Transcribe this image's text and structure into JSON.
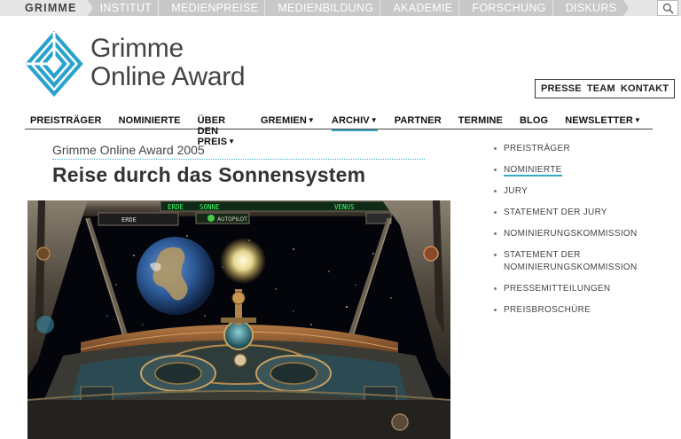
{
  "topbar": {
    "brand": "GRIMME",
    "items": [
      "INSTITUT",
      "MEDIENPREISE",
      "MEDIENBILDUNG",
      "AKADEMIE",
      "FORSCHUNG",
      "DISKURS"
    ]
  },
  "logo": {
    "line1": "Grimme",
    "line2": "Online Award"
  },
  "util": [
    "PRESSE",
    "TEAM",
    "KONTAKT"
  ],
  "mainnav": [
    {
      "label": "PREISTRÄGER",
      "dropdown": false
    },
    {
      "label": "NOMINIERTE",
      "dropdown": false
    },
    {
      "label": "ÜBER DEN PREIS",
      "dropdown": true
    },
    {
      "label": "GREMIEN",
      "dropdown": true
    },
    {
      "label": "ARCHIV",
      "dropdown": true,
      "active": true
    },
    {
      "label": "PARTNER",
      "dropdown": false
    },
    {
      "label": "TERMINE",
      "dropdown": false
    },
    {
      "label": "BLOG",
      "dropdown": false
    },
    {
      "label": "NEWSLETTER",
      "dropdown": true
    }
  ],
  "article": {
    "subtitle": "Grimme Online Award 2005",
    "title": "Reise durch das Sonnensystem"
  },
  "media": {
    "display_left": "ERDE",
    "display_center_left": "ERDE",
    "display_center_right": "SONNE",
    "display_right": "VENUS",
    "autopilot": "AUTOPILOT"
  },
  "sidenav": [
    {
      "label": "PREISTRÄGER"
    },
    {
      "label": "NOMINIERTE",
      "active": true
    },
    {
      "label": "JURY"
    },
    {
      "label": "STATEMENT DER JURY"
    },
    {
      "label": "NOMINIERUNGSKOMMISSION"
    },
    {
      "label": "STATEMENT DER NOMINIERUNGSKOMMISSION"
    },
    {
      "label": "PRESSEMITTEILUNGEN"
    },
    {
      "label": "PREISBROSCHÜRE"
    }
  ],
  "colors": {
    "accent": "#39a8c8",
    "topbar": "#e6e6e6",
    "topbar_item": "#c8c8c8"
  }
}
